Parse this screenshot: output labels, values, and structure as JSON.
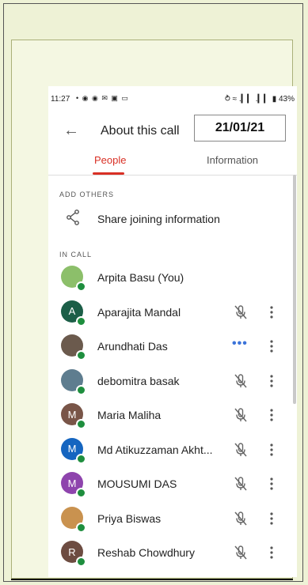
{
  "status": {
    "time": "11:27",
    "icons": "• ◉ ◉ ✉ ▣ ▭",
    "right": "⥁ ≈ .▎▎ .▎▎ ▮ 43%"
  },
  "header": {
    "back_icon": "←",
    "title": "About this call",
    "date": "21/01/21"
  },
  "tabs": [
    {
      "label": "People"
    },
    {
      "label": "Information"
    }
  ],
  "sections": {
    "add_others": "ADD OTHERS",
    "in_call": "IN CALL"
  },
  "share": {
    "label": "Share joining information",
    "icon": "share-icon"
  },
  "participants": [
    {
      "name": "Arpita Basu (You)",
      "initial": "",
      "avatar_color": "#8cbf6a",
      "state": "self"
    },
    {
      "name": "Aparajita Mandal",
      "initial": "A",
      "avatar_color": "#1b5e47",
      "state": "muted"
    },
    {
      "name": "Arundhati Das",
      "initial": "",
      "avatar_color": "#6b5a4d",
      "state": "speaking"
    },
    {
      "name": "debomitra basak",
      "initial": "",
      "avatar_color": "#5e7d8f",
      "state": "muted"
    },
    {
      "name": "Maria Maliha",
      "initial": "M",
      "avatar_color": "#795548",
      "state": "muted"
    },
    {
      "name": "Md Atikuzzaman Akht...",
      "initial": "M",
      "avatar_color": "#1565c0",
      "state": "muted"
    },
    {
      "name": "MOUSUMI DAS",
      "initial": "M",
      "avatar_color": "#8e44ad",
      "state": "muted"
    },
    {
      "name": "Priya Biswas",
      "initial": "",
      "avatar_color": "#c9924f",
      "state": "muted"
    },
    {
      "name": "Reshab Chowdhury",
      "initial": "R",
      "avatar_color": "#6d4c41",
      "state": "muted"
    }
  ],
  "speaking_indicator": "•••"
}
